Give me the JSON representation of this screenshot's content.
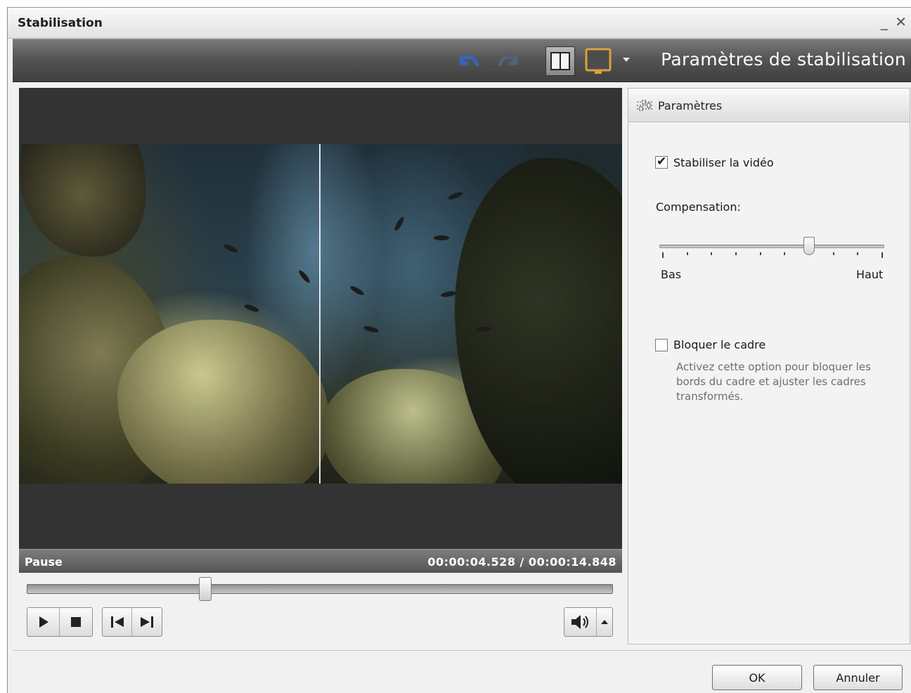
{
  "window": {
    "title": "Stabilisation",
    "minimize_glyph": "_",
    "close_glyph": "✕"
  },
  "toolbar": {
    "title": "Paramètres de stabilisation",
    "icons": [
      "undo-icon",
      "redo-icon",
      "split-view-icon",
      "monitor-icon",
      "chevron-down-icon"
    ]
  },
  "player": {
    "status": "Pause",
    "time": "00:00:04.528 / 00:00:14.848",
    "progress": 0.305,
    "controls": [
      "play-icon",
      "stop-icon",
      "previous-frame-icon",
      "next-frame-icon",
      "volume-icon",
      "chevron-up-icon"
    ]
  },
  "panel": {
    "header": "Paramètres",
    "stabilize": {
      "label": "Stabiliser la vidéo",
      "checked": true
    },
    "compensation": {
      "label": "Compensation:",
      "min_label": "Bas",
      "max_label": "Haut",
      "value": 0.67,
      "ticks": 10
    },
    "lock_frame": {
      "label": "Bloquer le cadre",
      "checked": false,
      "description": "Activez cette option pour bloquer les bords du cadre et ajuster les cadres transformés."
    }
  },
  "footer": {
    "ok_label": "OK",
    "cancel_label": "Annuler"
  },
  "colors": {
    "toolbar_dark": "#3f3f3f",
    "video_bg": "#333333",
    "accent_blue": "#3a63b7",
    "monitor_orange": "#d9a23a"
  }
}
